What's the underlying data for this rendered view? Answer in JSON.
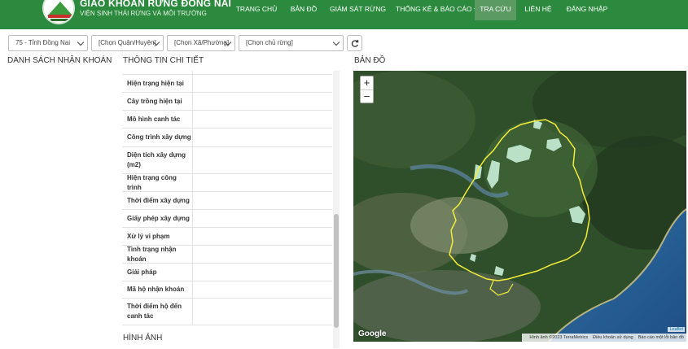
{
  "header": {
    "brand_title": "GIAO KHOÁN RỪNG ĐỒNG NAI",
    "brand_subtitle": "VIỆN SINH THÁI RỪNG VÀ MÔI TRƯỜNG",
    "nav": [
      {
        "label": "TRANG CHỦ"
      },
      {
        "label": "BẢN ĐỒ"
      },
      {
        "label": "GIÁM SÁT RỪNG"
      },
      {
        "label": "THỐNG KÊ & BÁO CÁO"
      },
      {
        "label": "TRA CỨU"
      },
      {
        "label": "LIÊN HỆ"
      },
      {
        "label": "ĐĂNG NHẬP"
      }
    ],
    "active_nav": "TRA CỨU"
  },
  "filters": {
    "province": "75 - Tỉnh Đồng Nai",
    "district": "[Chọn Quận/Huyện]",
    "ward": "[Chọn Xã/Phường]",
    "owner": "[Chọn chủ rừng]"
  },
  "sections": {
    "list_title": "DANH SÁCH NHẬN KHOÁN",
    "detail_title": "THÔNG TIN CHI TIẾT",
    "map_title": "BẢN ĐỒ",
    "images_title": "HÌNH ẢNH"
  },
  "detail_rows": [
    {
      "label": "Hiện trạng hiện tại",
      "value": ""
    },
    {
      "label": "Cây trồng hiện tại",
      "value": ""
    },
    {
      "label": "Mô hình canh tác",
      "value": ""
    },
    {
      "label": "Công trình xây dựng",
      "value": ""
    },
    {
      "label": "Diện tích xây dựng (m2)",
      "value": ""
    },
    {
      "label": "Hiện trạng công trình",
      "value": ""
    },
    {
      "label": "Thời điểm xây dựng",
      "value": ""
    },
    {
      "label": "Giấy phép xây dựng",
      "value": ""
    },
    {
      "label": "Xử lý vi phạm",
      "value": ""
    },
    {
      "label": "Tình trạng nhận khoán",
      "value": ""
    },
    {
      "label": "Giải pháp",
      "value": ""
    },
    {
      "label": "Mã hộ nhận khoán",
      "value": ""
    },
    {
      "label": "Thời điểm hộ đến canh tác",
      "value": ""
    }
  ],
  "map": {
    "zoom_in": "+",
    "zoom_out": "−",
    "google_logo": "Google",
    "attribution": "Hình ảnh ©2023 TerraMetrics",
    "terms": "Điều khoản sử dụng",
    "report": "Báo cáo một lỗi bản đồ",
    "leaflet": "Leaflet",
    "boundary_color": "#f2ec3a",
    "forest_patch_color": "#c8f0d8"
  },
  "colors": {
    "header_bg": "#2b8a3e",
    "active_nav_bg": "#5b9a63"
  }
}
